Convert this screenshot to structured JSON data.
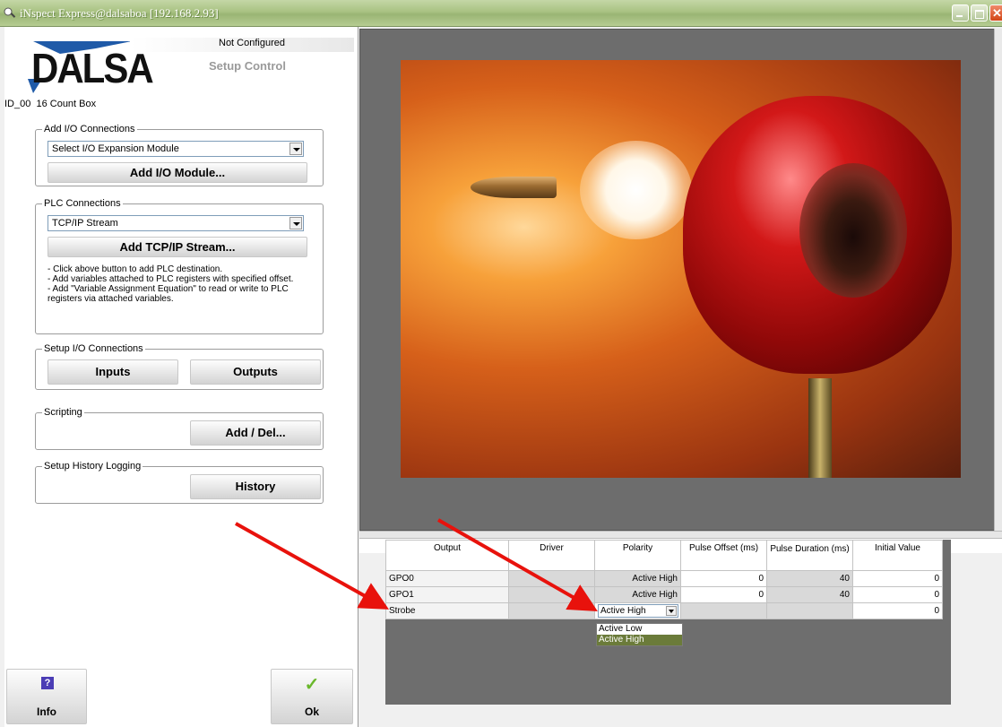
{
  "window": {
    "title": "iNspect Express@dalsaboa [192.168.2.93]"
  },
  "header": {
    "logo_text": "DALSA",
    "status": "Not Configured",
    "setup_label": "Setup Control",
    "job_id": "ID_00  16 Count Box"
  },
  "io": {
    "group_label": "Add I/O Connections",
    "select_value": "Select I/O Expansion Module",
    "add_button": "Add I/O Module..."
  },
  "plc": {
    "group_label": "PLC Connections",
    "select_value": "TCP/IP Stream",
    "add_button": "Add TCP/IP Stream...",
    "notes": [
      "- Click above button to add PLC destination.",
      "- Add variables attached to PLC registers with specified offset.",
      "- Add \"Variable Assignment Equation\" to read or write to PLC",
      "registers via attached variables."
    ]
  },
  "setup_io": {
    "group_label": "Setup I/O Connections",
    "inputs": "Inputs",
    "outputs": "Outputs"
  },
  "scripting": {
    "group_label": "Scripting",
    "button": "Add / Del..."
  },
  "history": {
    "group_label": "Setup History Logging",
    "button": "History"
  },
  "footer": {
    "info_label": "Info",
    "info_icon": "?",
    "ok_label": "Ok",
    "ok_icon": "✓"
  },
  "ruler": {
    "marks": [
      "+",
      "+",
      "■",
      "–",
      "–"
    ]
  },
  "table": {
    "columns": [
      "Output",
      "Driver",
      "Polarity",
      "Pulse Offset (ms)",
      "Pulse Duration (ms)",
      "Initial Value"
    ],
    "rows": [
      {
        "output": "GPO0",
        "driver": "",
        "polarity": "Active High",
        "offset": "0",
        "duration": "40",
        "initial": "0"
      },
      {
        "output": "GPO1",
        "driver": "",
        "polarity": "Active High",
        "offset": "0",
        "duration": "40",
        "initial": "0"
      },
      {
        "output": "Strobe",
        "driver": "",
        "polarity": "Active High",
        "offset": "",
        "duration": "",
        "initial": "0"
      }
    ],
    "polarity_options": [
      "Active Low",
      "Active High"
    ]
  },
  "colors": {
    "accent_blue": "#1f5aa8",
    "annotation_red": "#e8120c",
    "titlebar": "#a9c282"
  }
}
